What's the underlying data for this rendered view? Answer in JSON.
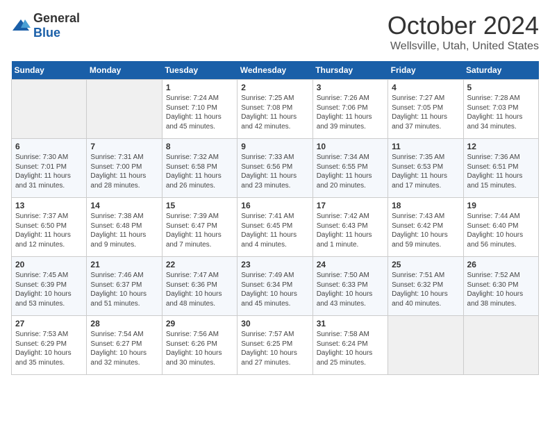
{
  "header": {
    "logo_general": "General",
    "logo_blue": "Blue",
    "month_title": "October 2024",
    "location": "Wellsville, Utah, United States"
  },
  "days_of_week": [
    "Sunday",
    "Monday",
    "Tuesday",
    "Wednesday",
    "Thursday",
    "Friday",
    "Saturday"
  ],
  "weeks": [
    [
      {
        "day": null
      },
      {
        "day": null
      },
      {
        "day": 1,
        "sunrise": "7:24 AM",
        "sunset": "7:10 PM",
        "daylight": "11 hours and 45 minutes."
      },
      {
        "day": 2,
        "sunrise": "7:25 AM",
        "sunset": "7:08 PM",
        "daylight": "11 hours and 42 minutes."
      },
      {
        "day": 3,
        "sunrise": "7:26 AM",
        "sunset": "7:06 PM",
        "daylight": "11 hours and 39 minutes."
      },
      {
        "day": 4,
        "sunrise": "7:27 AM",
        "sunset": "7:05 PM",
        "daylight": "11 hours and 37 minutes."
      },
      {
        "day": 5,
        "sunrise": "7:28 AM",
        "sunset": "7:03 PM",
        "daylight": "11 hours and 34 minutes."
      }
    ],
    [
      {
        "day": 6,
        "sunrise": "7:30 AM",
        "sunset": "7:01 PM",
        "daylight": "11 hours and 31 minutes."
      },
      {
        "day": 7,
        "sunrise": "7:31 AM",
        "sunset": "7:00 PM",
        "daylight": "11 hours and 28 minutes."
      },
      {
        "day": 8,
        "sunrise": "7:32 AM",
        "sunset": "6:58 PM",
        "daylight": "11 hours and 26 minutes."
      },
      {
        "day": 9,
        "sunrise": "7:33 AM",
        "sunset": "6:56 PM",
        "daylight": "11 hours and 23 minutes."
      },
      {
        "day": 10,
        "sunrise": "7:34 AM",
        "sunset": "6:55 PM",
        "daylight": "11 hours and 20 minutes."
      },
      {
        "day": 11,
        "sunrise": "7:35 AM",
        "sunset": "6:53 PM",
        "daylight": "11 hours and 17 minutes."
      },
      {
        "day": 12,
        "sunrise": "7:36 AM",
        "sunset": "6:51 PM",
        "daylight": "11 hours and 15 minutes."
      }
    ],
    [
      {
        "day": 13,
        "sunrise": "7:37 AM",
        "sunset": "6:50 PM",
        "daylight": "11 hours and 12 minutes."
      },
      {
        "day": 14,
        "sunrise": "7:38 AM",
        "sunset": "6:48 PM",
        "daylight": "11 hours and 9 minutes."
      },
      {
        "day": 15,
        "sunrise": "7:39 AM",
        "sunset": "6:47 PM",
        "daylight": "11 hours and 7 minutes."
      },
      {
        "day": 16,
        "sunrise": "7:41 AM",
        "sunset": "6:45 PM",
        "daylight": "11 hours and 4 minutes."
      },
      {
        "day": 17,
        "sunrise": "7:42 AM",
        "sunset": "6:43 PM",
        "daylight": "11 hours and 1 minute."
      },
      {
        "day": 18,
        "sunrise": "7:43 AM",
        "sunset": "6:42 PM",
        "daylight": "10 hours and 59 minutes."
      },
      {
        "day": 19,
        "sunrise": "7:44 AM",
        "sunset": "6:40 PM",
        "daylight": "10 hours and 56 minutes."
      }
    ],
    [
      {
        "day": 20,
        "sunrise": "7:45 AM",
        "sunset": "6:39 PM",
        "daylight": "10 hours and 53 minutes."
      },
      {
        "day": 21,
        "sunrise": "7:46 AM",
        "sunset": "6:37 PM",
        "daylight": "10 hours and 51 minutes."
      },
      {
        "day": 22,
        "sunrise": "7:47 AM",
        "sunset": "6:36 PM",
        "daylight": "10 hours and 48 minutes."
      },
      {
        "day": 23,
        "sunrise": "7:49 AM",
        "sunset": "6:34 PM",
        "daylight": "10 hours and 45 minutes."
      },
      {
        "day": 24,
        "sunrise": "7:50 AM",
        "sunset": "6:33 PM",
        "daylight": "10 hours and 43 minutes."
      },
      {
        "day": 25,
        "sunrise": "7:51 AM",
        "sunset": "6:32 PM",
        "daylight": "10 hours and 40 minutes."
      },
      {
        "day": 26,
        "sunrise": "7:52 AM",
        "sunset": "6:30 PM",
        "daylight": "10 hours and 38 minutes."
      }
    ],
    [
      {
        "day": 27,
        "sunrise": "7:53 AM",
        "sunset": "6:29 PM",
        "daylight": "10 hours and 35 minutes."
      },
      {
        "day": 28,
        "sunrise": "7:54 AM",
        "sunset": "6:27 PM",
        "daylight": "10 hours and 32 minutes."
      },
      {
        "day": 29,
        "sunrise": "7:56 AM",
        "sunset": "6:26 PM",
        "daylight": "10 hours and 30 minutes."
      },
      {
        "day": 30,
        "sunrise": "7:57 AM",
        "sunset": "6:25 PM",
        "daylight": "10 hours and 27 minutes."
      },
      {
        "day": 31,
        "sunrise": "7:58 AM",
        "sunset": "6:24 PM",
        "daylight": "10 hours and 25 minutes."
      },
      {
        "day": null
      },
      {
        "day": null
      }
    ]
  ]
}
